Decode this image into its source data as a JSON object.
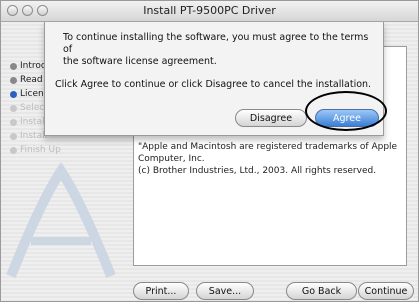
{
  "window": {
    "title": "Install PT-9500PC Driver"
  },
  "sidebar": {
    "steps": [
      {
        "label": "Introduction",
        "state": "done"
      },
      {
        "label": "Read Me",
        "state": "done"
      },
      {
        "label": "License",
        "state": "active"
      },
      {
        "label": "Select Destination",
        "state": "pending"
      },
      {
        "label": "Installation Type",
        "state": "pending"
      },
      {
        "label": "Install",
        "state": "pending"
      },
      {
        "label": "Finish Up",
        "state": "pending"
      }
    ]
  },
  "license_text": {
    "line1": "\"Apple and Macintosh are registered trademarks of Apple",
    "line2": "Computer, Inc.",
    "line3": "(c) Brother Industries, Ltd., 2003. All rights reserved."
  },
  "buttons": {
    "print": "Print...",
    "save": "Save...",
    "go_back": "Go Back",
    "continue": "Continue"
  },
  "dialog": {
    "message_line1": "To continue installing the software, you must agree to the terms of",
    "message_line2": "the software license agreement.",
    "instruction": "Click Agree to continue or click Disagree to cancel the installation.",
    "disagree": "Disagree",
    "agree": "Agree"
  },
  "colors": {
    "accent": "#3b7fd6",
    "active_step": "#2d5fc2"
  }
}
